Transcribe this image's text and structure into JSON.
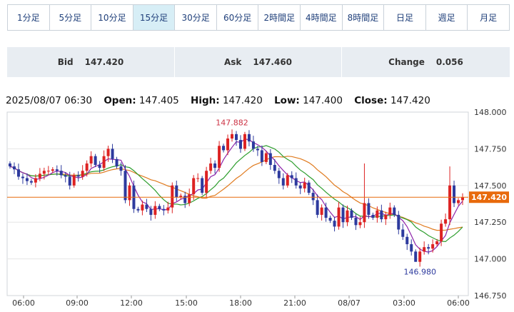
{
  "tabs": [
    "1分足",
    "5分足",
    "10分足",
    "15分足",
    "30分足",
    "60分足",
    "2時間足",
    "4時間足",
    "8時間足",
    "日足",
    "週足",
    "月足"
  ],
  "active_tab": "15分足",
  "quote": {
    "bid_label": "Bid",
    "bid_value": "147.420",
    "ask_label": "Ask",
    "ask_value": "147.460",
    "change_label": "Change",
    "change_value": "0.056"
  },
  "ohlc": {
    "datetime": "2025/08/07 06:30",
    "open_label": "Open:",
    "open": "147.405",
    "high_label": "High:",
    "high": "147.420",
    "low_label": "Low:",
    "low": "147.400",
    "close_label": "Close:",
    "close": "147.420"
  },
  "chart_data": {
    "type": "candlestick",
    "y_ticks": [
      "148.000",
      "147.750",
      "147.500",
      "147.250",
      "147.000",
      "146.750"
    ],
    "y_range": [
      146.75,
      148.0
    ],
    "x_ticks": [
      "06:00",
      "09:00",
      "12:00",
      "15:00",
      "18:00",
      "21:00",
      "08/07",
      "03:00",
      "06:00"
    ],
    "current_price": "147.420",
    "annotations": {
      "high": "147.882",
      "low": "146.980"
    },
    "colors": {
      "up": "#dd2222",
      "down": "#2d3a9e",
      "ma_short": "#8e24aa",
      "ma_mid": "#2e9e2e",
      "ma_long": "#e07b1f",
      "price_line": "#e86a0c"
    },
    "closes": [
      147.63,
      147.61,
      147.56,
      147.55,
      147.53,
      147.52,
      147.55,
      147.58,
      147.6,
      147.6,
      147.61,
      147.6,
      147.57,
      147.56,
      147.5,
      147.57,
      147.56,
      147.6,
      147.65,
      147.7,
      147.64,
      147.62,
      147.7,
      147.75,
      147.68,
      147.63,
      147.6,
      147.4,
      147.5,
      147.34,
      147.33,
      147.37,
      147.34,
      147.3,
      147.36,
      147.34,
      147.33,
      147.35,
      147.5,
      147.42,
      147.43,
      147.38,
      147.44,
      147.55,
      147.55,
      147.45,
      147.6,
      147.65,
      147.62,
      147.77,
      147.74,
      147.82,
      147.85,
      147.81,
      147.75,
      147.85,
      147.8,
      147.75,
      147.74,
      147.66,
      147.72,
      147.64,
      147.6,
      147.55,
      147.5,
      147.57,
      147.55,
      147.5,
      147.48,
      147.52,
      147.45,
      147.4,
      147.3,
      147.35,
      147.28,
      147.26,
      147.22,
      147.35,
      147.25,
      147.33,
      147.28,
      147.23,
      147.25,
      147.38,
      147.3,
      147.28,
      147.33,
      147.27,
      147.3,
      147.35,
      147.3,
      147.2,
      147.15,
      147.1,
      147.05,
      146.98,
      147.05,
      147.08,
      147.07,
      147.1,
      147.12,
      147.24,
      147.27,
      147.5,
      147.38,
      147.4,
      147.42
    ]
  }
}
